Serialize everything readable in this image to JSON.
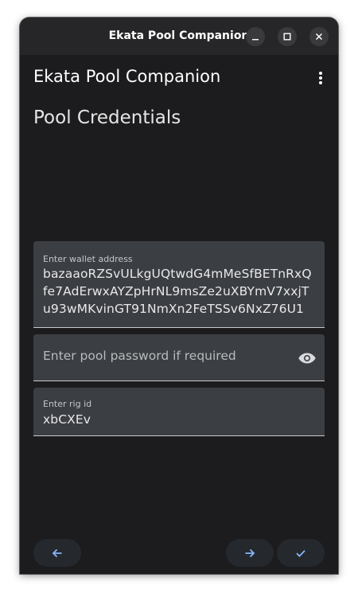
{
  "window": {
    "title": "Ekata Pool Companion"
  },
  "appbar": {
    "title": "Ekata Pool Companion",
    "menu_icon": "more-vert-icon"
  },
  "page": {
    "heading": "Pool Credentials"
  },
  "form": {
    "wallet": {
      "label": "Enter wallet address",
      "value": "bazaaoRZSvULkgUQtwdG4mMeSfBETnRxQfe7AdErwxAYZpHrNL9msZe2uXBYmV7xxjTu93wMKvinGT91NmXn2FeTSSv6NxZ76U1"
    },
    "password": {
      "placeholder": "Enter pool password if required",
      "toggle_icon": "eye-icon"
    },
    "rig": {
      "label": "Enter rig id",
      "value": "xbCXEv"
    }
  },
  "actions": {
    "back_icon": "arrow-left-icon",
    "next_icon": "arrow-right-icon",
    "done_icon": "check-icon"
  },
  "colors": {
    "background": "#1c1c1e",
    "titlebar": "#262628",
    "field": "#3b3e42",
    "accent": "#8ab4f8"
  }
}
